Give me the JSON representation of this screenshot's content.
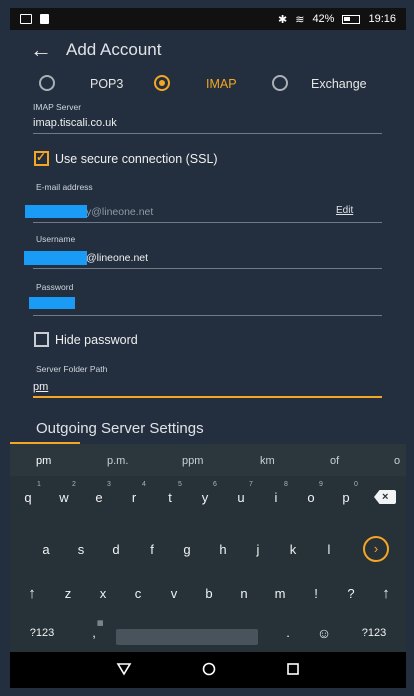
{
  "status": {
    "percent": "42%",
    "time": "19:16"
  },
  "appbar": {
    "title": "Add Account"
  },
  "protocols": {
    "pop3": "POP3",
    "imap": "IMAP",
    "exchange": "Exchange",
    "selected": "IMAP"
  },
  "imap_server": {
    "label": "IMAP Server",
    "value": "imap.tiscali.co.uk"
  },
  "ssl": {
    "label": "Use secure connection (SSL)",
    "checked": true
  },
  "email": {
    "label": "E-mail address",
    "suffix": "y@lineone.net",
    "edit": "Edit"
  },
  "username": {
    "label": "Username",
    "suffix": "@lineone.net"
  },
  "password": {
    "label": "Password"
  },
  "hide_password": {
    "label": "Hide password",
    "checked": false
  },
  "folder_path": {
    "label": "Server Folder Path",
    "value": "pm"
  },
  "outgoing": {
    "title": "Outgoing Server Settings"
  },
  "keyboard": {
    "suggestions": [
      "pm",
      "p.m.",
      "ppm",
      "km",
      "of",
      "o"
    ],
    "row1": [
      "q",
      "w",
      "e",
      "r",
      "t",
      "y",
      "u",
      "i",
      "o",
      "p"
    ],
    "row1_digits": [
      "1",
      "2",
      "3",
      "4",
      "5",
      "6",
      "7",
      "8",
      "9",
      "0"
    ],
    "row2": [
      "a",
      "s",
      "d",
      "f",
      "g",
      "h",
      "j",
      "k",
      "l"
    ],
    "row3": [
      "z",
      "x",
      "c",
      "v",
      "b",
      "n",
      "m",
      "!",
      "?"
    ],
    "symbols_key": "?123",
    "comma": ",",
    "period": ".",
    "symbols_key_right": "?123"
  },
  "colors": {
    "accent": "#f5a623",
    "background": "#232f3e",
    "redaction": "#1a9bf5"
  }
}
